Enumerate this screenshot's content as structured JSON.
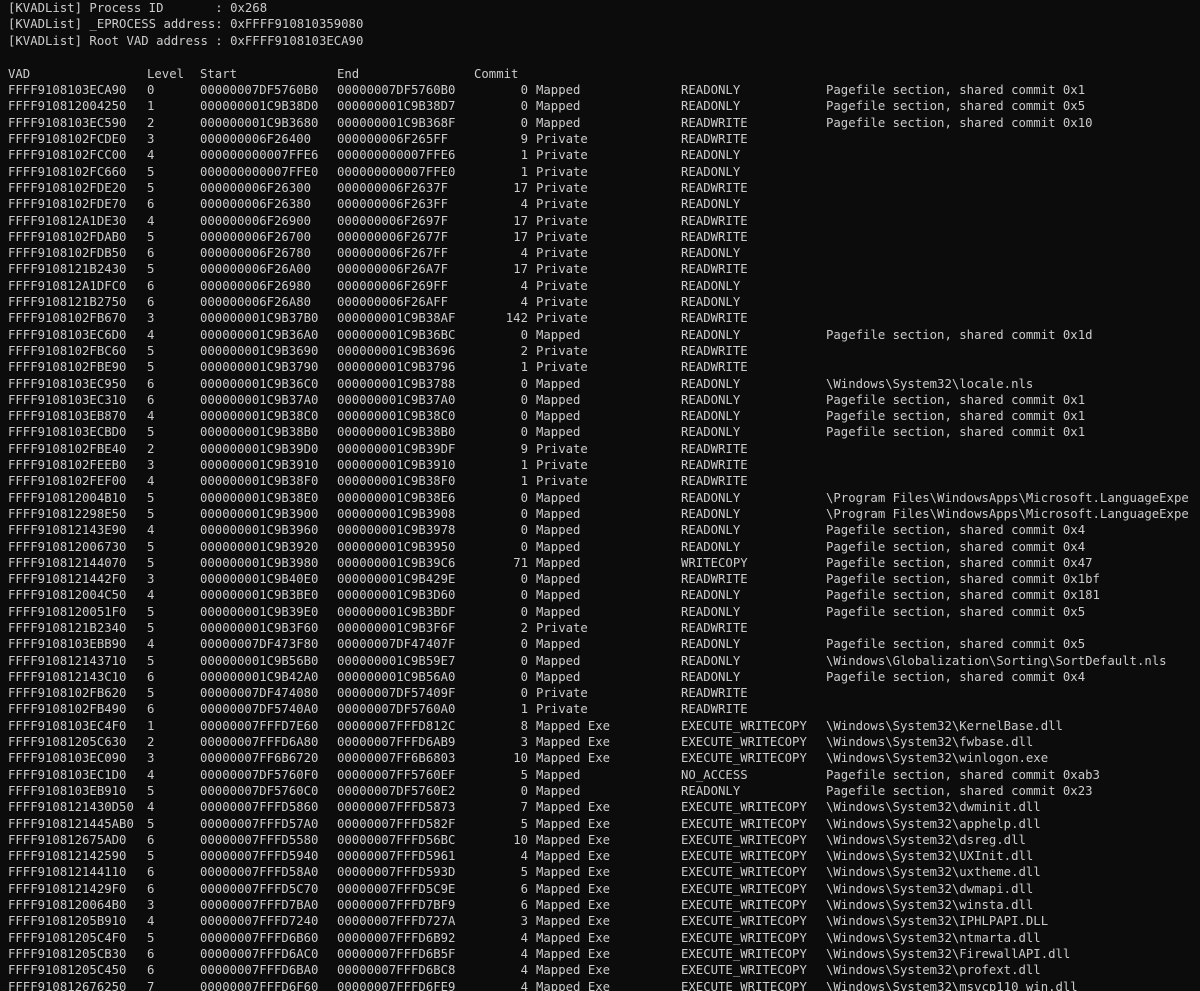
{
  "header_lines": [
    "[KVADList] Process ID       : 0x268",
    "[KVADList] _EPROCESS address: 0xFFFF910810359080",
    "[KVADList] Root VAD address : 0xFFFF9108103ECA90"
  ],
  "columns": {
    "vad": "VAD",
    "level": "Level",
    "start": "Start",
    "end": "End",
    "commit": "Commit"
  },
  "rows": [
    {
      "vad": "FFFF9108103ECA90",
      "level": "0",
      "start": "00000007DF5760B0",
      "end": "00000007DF5760B0",
      "commit": "0",
      "type": "Mapped",
      "prot": "READONLY",
      "desc": "Pagefile section, shared commit 0x1"
    },
    {
      "vad": "FFFF910812004250",
      "level": "1",
      "start": "000000001C9B38D0",
      "end": "000000001C9B38D7",
      "commit": "0",
      "type": "Mapped",
      "prot": "READONLY",
      "desc": "Pagefile section, shared commit 0x5"
    },
    {
      "vad": "FFFF9108103EC590",
      "level": "2",
      "start": "000000001C9B3680",
      "end": "000000001C9B368F",
      "commit": "0",
      "type": "Mapped",
      "prot": "READWRITE",
      "desc": "Pagefile section, shared commit 0x10"
    },
    {
      "vad": "FFFF9108102FCDE0",
      "level": "3",
      "start": "000000006F26400",
      "end": "000000006F265FF",
      "commit": "9",
      "type": "Private",
      "prot": "READWRITE",
      "desc": ""
    },
    {
      "vad": "FFFF9108102FCC00",
      "level": "4",
      "start": "000000000007FFE6",
      "end": "000000000007FFE6",
      "commit": "1",
      "type": "Private",
      "prot": "READONLY",
      "desc": ""
    },
    {
      "vad": "FFFF9108102FC660",
      "level": "5",
      "start": "000000000007FFE0",
      "end": "000000000007FFE0",
      "commit": "1",
      "type": "Private",
      "prot": "READONLY",
      "desc": ""
    },
    {
      "vad": "FFFF9108102FDE20",
      "level": "5",
      "start": "000000006F26300",
      "end": "000000006F2637F",
      "commit": "17",
      "type": "Private",
      "prot": "READWRITE",
      "desc": ""
    },
    {
      "vad": "FFFF9108102FDE70",
      "level": "6",
      "start": "000000006F26380",
      "end": "000000006F263FF",
      "commit": "4",
      "type": "Private",
      "prot": "READONLY",
      "desc": ""
    },
    {
      "vad": "FFFF910812A1DE30",
      "level": "4",
      "start": "000000006F26900",
      "end": "000000006F2697F",
      "commit": "17",
      "type": "Private",
      "prot": "READWRITE",
      "desc": ""
    },
    {
      "vad": "FFFF9108102FDAB0",
      "level": "5",
      "start": "000000006F26700",
      "end": "000000006F2677F",
      "commit": "17",
      "type": "Private",
      "prot": "READWRITE",
      "desc": ""
    },
    {
      "vad": "FFFF9108102FDB50",
      "level": "6",
      "start": "000000006F26780",
      "end": "000000006F267FF",
      "commit": "4",
      "type": "Private",
      "prot": "READONLY",
      "desc": ""
    },
    {
      "vad": "FFFF9108121B2430",
      "level": "5",
      "start": "000000006F26A00",
      "end": "000000006F26A7F",
      "commit": "17",
      "type": "Private",
      "prot": "READWRITE",
      "desc": ""
    },
    {
      "vad": "FFFF910812A1DFC0",
      "level": "6",
      "start": "000000006F26980",
      "end": "000000006F269FF",
      "commit": "4",
      "type": "Private",
      "prot": "READONLY",
      "desc": ""
    },
    {
      "vad": "FFFF9108121B2750",
      "level": "6",
      "start": "000000006F26A80",
      "end": "000000006F26AFF",
      "commit": "4",
      "type": "Private",
      "prot": "READONLY",
      "desc": ""
    },
    {
      "vad": "FFFF9108102FB670",
      "level": "3",
      "start": "000000001C9B37B0",
      "end": "000000001C9B38AF",
      "commit": "142",
      "type": "Private",
      "prot": "READWRITE",
      "desc": ""
    },
    {
      "vad": "FFFF9108103EC6D0",
      "level": "4",
      "start": "000000001C9B36A0",
      "end": "000000001C9B36BC",
      "commit": "0",
      "type": "Mapped",
      "prot": "READONLY",
      "desc": "Pagefile section, shared commit 0x1d"
    },
    {
      "vad": "FFFF9108102FBC60",
      "level": "5",
      "start": "000000001C9B3690",
      "end": "000000001C9B3696",
      "commit": "2",
      "type": "Private",
      "prot": "READWRITE",
      "desc": ""
    },
    {
      "vad": "FFFF9108102FBE90",
      "level": "5",
      "start": "000000001C9B3790",
      "end": "000000001C9B3796",
      "commit": "1",
      "type": "Private",
      "prot": "READWRITE",
      "desc": ""
    },
    {
      "vad": "FFFF9108103EC950",
      "level": "6",
      "start": "000000001C9B36C0",
      "end": "000000001C9B3788",
      "commit": "0",
      "type": "Mapped",
      "prot": "READONLY",
      "desc": "\\Windows\\System32\\locale.nls"
    },
    {
      "vad": "FFFF9108103EC310",
      "level": "6",
      "start": "000000001C9B37A0",
      "end": "000000001C9B37A0",
      "commit": "0",
      "type": "Mapped",
      "prot": "READONLY",
      "desc": "Pagefile section, shared commit 0x1"
    },
    {
      "vad": "FFFF9108103EB870",
      "level": "4",
      "start": "000000001C9B38C0",
      "end": "000000001C9B38C0",
      "commit": "0",
      "type": "Mapped",
      "prot": "READONLY",
      "desc": "Pagefile section, shared commit 0x1"
    },
    {
      "vad": "FFFF9108103ECBD0",
      "level": "5",
      "start": "000000001C9B38B0",
      "end": "000000001C9B38B0",
      "commit": "0",
      "type": "Mapped",
      "prot": "READONLY",
      "desc": "Pagefile section, shared commit 0x1"
    },
    {
      "vad": "FFFF9108102FBE40",
      "level": "2",
      "start": "000000001C9B39D0",
      "end": "000000001C9B39DF",
      "commit": "9",
      "type": "Private",
      "prot": "READWRITE",
      "desc": ""
    },
    {
      "vad": "FFFF9108102FEEB0",
      "level": "3",
      "start": "000000001C9B3910",
      "end": "000000001C9B3910",
      "commit": "1",
      "type": "Private",
      "prot": "READWRITE",
      "desc": ""
    },
    {
      "vad": "FFFF9108102FEF00",
      "level": "4",
      "start": "000000001C9B38F0",
      "end": "000000001C9B38F0",
      "commit": "1",
      "type": "Private",
      "prot": "READWRITE",
      "desc": ""
    },
    {
      "vad": "FFFF910812004B10",
      "level": "5",
      "start": "000000001C9B38E0",
      "end": "000000001C9B38E6",
      "commit": "0",
      "type": "Mapped",
      "prot": "READONLY",
      "desc": "\\Program Files\\WindowsApps\\Microsoft.LanguageExpe"
    },
    {
      "vad": "FFFF910812298E50",
      "level": "5",
      "start": "000000001C9B3900",
      "end": "000000001C9B3908",
      "commit": "0",
      "type": "Mapped",
      "prot": "READONLY",
      "desc": "\\Program Files\\WindowsApps\\Microsoft.LanguageExpe"
    },
    {
      "vad": "FFFF910812143E90",
      "level": "4",
      "start": "000000001C9B3960",
      "end": "000000001C9B3978",
      "commit": "0",
      "type": "Mapped",
      "prot": "READONLY",
      "desc": "Pagefile section, shared commit 0x4"
    },
    {
      "vad": "FFFF910812006730",
      "level": "5",
      "start": "000000001C9B3920",
      "end": "000000001C9B3950",
      "commit": "0",
      "type": "Mapped",
      "prot": "READONLY",
      "desc": "Pagefile section, shared commit 0x4"
    },
    {
      "vad": "FFFF910812144070",
      "level": "5",
      "start": "000000001C9B3980",
      "end": "000000001C9B39C6",
      "commit": "71",
      "type": "Mapped",
      "prot": "WRITECOPY",
      "desc": "Pagefile section, shared commit 0x47"
    },
    {
      "vad": "FFFF9108121442F0",
      "level": "3",
      "start": "000000001C9B40E0",
      "end": "000000001C9B429E",
      "commit": "0",
      "type": "Mapped",
      "prot": "READWRITE",
      "desc": "Pagefile section, shared commit 0x1bf"
    },
    {
      "vad": "FFFF910812004C50",
      "level": "4",
      "start": "000000001C9B3BE0",
      "end": "000000001C9B3D60",
      "commit": "0",
      "type": "Mapped",
      "prot": "READONLY",
      "desc": "Pagefile section, shared commit 0x181"
    },
    {
      "vad": "FFFF9108120051F0",
      "level": "5",
      "start": "000000001C9B39E0",
      "end": "000000001C9B3BDF",
      "commit": "0",
      "type": "Mapped",
      "prot": "READONLY",
      "desc": "Pagefile section, shared commit 0x5"
    },
    {
      "vad": "FFFF9108121B2340",
      "level": "5",
      "start": "000000001C9B3F60",
      "end": "000000001C9B3F6F",
      "commit": "2",
      "type": "Private",
      "prot": "READWRITE",
      "desc": ""
    },
    {
      "vad": "FFFF9108103EBB90",
      "level": "4",
      "start": "00000007DF473F80",
      "end": "00000007DF47407F",
      "commit": "0",
      "type": "Mapped",
      "prot": "READONLY",
      "desc": "Pagefile section, shared commit 0x5"
    },
    {
      "vad": "FFFF910812143710",
      "level": "5",
      "start": "000000001C9B56B0",
      "end": "000000001C9B59E7",
      "commit": "0",
      "type": "Mapped",
      "prot": "READONLY",
      "desc": "\\Windows\\Globalization\\Sorting\\SortDefault.nls"
    },
    {
      "vad": "FFFF910812143C10",
      "level": "6",
      "start": "000000001C9B42A0",
      "end": "000000001C9B56A0",
      "commit": "0",
      "type": "Mapped",
      "prot": "READONLY",
      "desc": "Pagefile section, shared commit 0x4"
    },
    {
      "vad": "FFFF9108102FB620",
      "level": "5",
      "start": "00000007DF474080",
      "end": "00000007DF57409F",
      "commit": "0",
      "type": "Private",
      "prot": "READWRITE",
      "desc": ""
    },
    {
      "vad": "FFFF9108102FB490",
      "level": "6",
      "start": "00000007DF5740A0",
      "end": "00000007DF5760A0",
      "commit": "1",
      "type": "Private",
      "prot": "READWRITE",
      "desc": ""
    },
    {
      "vad": "FFFF9108103EC4F0",
      "level": "1",
      "start": "00000007FFFD7E60",
      "end": "00000007FFFD812C",
      "commit": "8",
      "type": "Mapped Exe",
      "prot": "EXECUTE_WRITECOPY",
      "desc": "\\Windows\\System32\\KernelBase.dll"
    },
    {
      "vad": "FFFF91081205C630",
      "level": "2",
      "start": "00000007FFFD6A80",
      "end": "00000007FFFD6AB9",
      "commit": "3",
      "type": "Mapped Exe",
      "prot": "EXECUTE_WRITECOPY",
      "desc": "\\Windows\\System32\\fwbase.dll"
    },
    {
      "vad": "FFFF9108103EC090",
      "level": "3",
      "start": "00000007FF6B6720",
      "end": "00000007FF6B6803",
      "commit": "10",
      "type": "Mapped Exe",
      "prot": "EXECUTE_WRITECOPY",
      "desc": "\\Windows\\System32\\winlogon.exe"
    },
    {
      "vad": "FFFF9108103EC1D0",
      "level": "4",
      "start": "00000007DF5760F0",
      "end": "00000007FF5760EF",
      "commit": "5",
      "type": "Mapped",
      "prot": "NO_ACCESS",
      "desc": "Pagefile section, shared commit 0xab3"
    },
    {
      "vad": "FFFF9108103EB910",
      "level": "5",
      "start": "00000007DF5760C0",
      "end": "00000007DF5760E2",
      "commit": "0",
      "type": "Mapped",
      "prot": "READONLY",
      "desc": "Pagefile section, shared commit 0x23"
    },
    {
      "vad": "FFFF9108121430D50",
      "level": "4",
      "start": "00000007FFFD5860",
      "end": "00000007FFFD5873",
      "commit": "7",
      "type": "Mapped Exe",
      "prot": "EXECUTE_WRITECOPY",
      "desc": "\\Windows\\System32\\dwminit.dll"
    },
    {
      "vad": "FFFF9108121445AB0",
      "level": "5",
      "start": "00000007FFFD57A0",
      "end": "00000007FFFD582F",
      "commit": "5",
      "type": "Mapped Exe",
      "prot": "EXECUTE_WRITECOPY",
      "desc": "\\Windows\\System32\\apphelp.dll"
    },
    {
      "vad": "FFFF910812675AD0",
      "level": "6",
      "start": "00000007FFFD5580",
      "end": "00000007FFFD56BC",
      "commit": "10",
      "type": "Mapped Exe",
      "prot": "EXECUTE_WRITECOPY",
      "desc": "\\Windows\\System32\\dsreg.dll"
    },
    {
      "vad": "FFFF910812142590",
      "level": "5",
      "start": "00000007FFFD5940",
      "end": "00000007FFFD5961",
      "commit": "4",
      "type": "Mapped Exe",
      "prot": "EXECUTE_WRITECOPY",
      "desc": "\\Windows\\System32\\UXInit.dll"
    },
    {
      "vad": "FFFF910812144110",
      "level": "6",
      "start": "00000007FFFD58A0",
      "end": "00000007FFFD593D",
      "commit": "5",
      "type": "Mapped Exe",
      "prot": "EXECUTE_WRITECOPY",
      "desc": "\\Windows\\System32\\uxtheme.dll"
    },
    {
      "vad": "FFFF9108121429F0",
      "level": "6",
      "start": "00000007FFFD5C70",
      "end": "00000007FFFD5C9E",
      "commit": "6",
      "type": "Mapped Exe",
      "prot": "EXECUTE_WRITECOPY",
      "desc": "\\Windows\\System32\\dwmapi.dll"
    },
    {
      "vad": "FFFF9108120064B0",
      "level": "3",
      "start": "00000007FFFD7BA0",
      "end": "00000007FFFD7BF9",
      "commit": "6",
      "type": "Mapped Exe",
      "prot": "EXECUTE_WRITECOPY",
      "desc": "\\Windows\\System32\\winsta.dll"
    },
    {
      "vad": "FFFF91081205B910",
      "level": "4",
      "start": "00000007FFFD7240",
      "end": "00000007FFFD727A",
      "commit": "3",
      "type": "Mapped Exe",
      "prot": "EXECUTE_WRITECOPY",
      "desc": "\\Windows\\System32\\IPHLPAPI.DLL"
    },
    {
      "vad": "FFFF91081205C4F0",
      "level": "5",
      "start": "00000007FFFD6B60",
      "end": "00000007FFFD6B92",
      "commit": "4",
      "type": "Mapped Exe",
      "prot": "EXECUTE_WRITECOPY",
      "desc": "\\Windows\\System32\\ntmarta.dll"
    },
    {
      "vad": "FFFF91081205CB30",
      "level": "6",
      "start": "00000007FFFD6AC0",
      "end": "00000007FFFD6B5F",
      "commit": "4",
      "type": "Mapped Exe",
      "prot": "EXECUTE_WRITECOPY",
      "desc": "\\Windows\\System32\\FirewallAPI.dll"
    },
    {
      "vad": "FFFF91081205C450",
      "level": "6",
      "start": "00000007FFFD6BA0",
      "end": "00000007FFFD6BC8",
      "commit": "4",
      "type": "Mapped Exe",
      "prot": "EXECUTE_WRITECOPY",
      "desc": "\\Windows\\System32\\profext.dll"
    },
    {
      "vad": "FFFF910812676250",
      "level": "7",
      "start": "00000007FFFD6F60",
      "end": "00000007FFFD6FE9",
      "commit": "4",
      "type": "Mapped Exe",
      "prot": "EXECUTE_WRITECOPY",
      "desc": "\\Windows\\System32\\msvcp110_win.dll"
    }
  ]
}
